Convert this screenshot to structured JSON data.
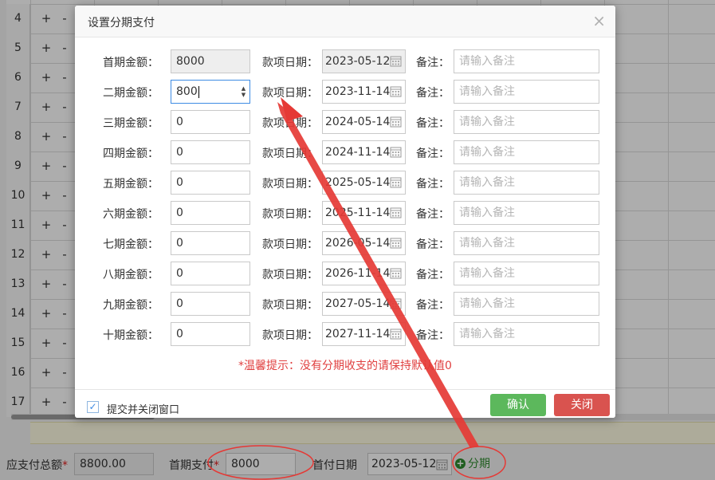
{
  "background": {
    "rows": [
      "4",
      "5",
      "6",
      "7",
      "8",
      "9",
      "10",
      "11",
      "12",
      "13",
      "14",
      "15",
      "16",
      "17"
    ],
    "plus": "+",
    "minus": "-",
    "footer": {
      "total_label": "应支付总额",
      "total_value": "8800.00",
      "first_label": "首期支付",
      "first_value": "8000",
      "first_date_label": "首付日期",
      "first_date_value": "2023-05-12",
      "installment_label": "分期",
      "required_mark": "*"
    }
  },
  "modal": {
    "title": "设置分期支付",
    "close_glyph": "×",
    "date_label": "款项日期：",
    "note_label": "备注：",
    "note_placeholder": "请输入备注",
    "installments": [
      {
        "label": "首期金额：",
        "amount": "8000",
        "date": "2023-05-12"
      },
      {
        "label": "二期金额：",
        "amount": "800",
        "date": "2023-11-14"
      },
      {
        "label": "三期金额：",
        "amount": "0",
        "date": "2024-05-14"
      },
      {
        "label": "四期金额：",
        "amount": "0",
        "date": "2024-11-14"
      },
      {
        "label": "五期金额：",
        "amount": "0",
        "date": "2025-05-14"
      },
      {
        "label": "六期金额：",
        "amount": "0",
        "date": "2025-11-14"
      },
      {
        "label": "七期金额：",
        "amount": "0",
        "date": "2026-05-14"
      },
      {
        "label": "八期金额：",
        "amount": "0",
        "date": "2026-11-14"
      },
      {
        "label": "九期金额：",
        "amount": "0",
        "date": "2027-05-14"
      },
      {
        "label": "十期金额：",
        "amount": "0",
        "date": "2027-11-14"
      }
    ],
    "tip": "*温馨提示：没有分期收支的请保持默认值0",
    "close_on_submit_label": "提交并关闭窗口",
    "close_on_submit_checked": true,
    "confirm_label": "确认",
    "close_label": "关闭"
  },
  "colors": {
    "confirm": "#5cb85c",
    "close": "#d9534f",
    "tip": "#e04040",
    "annotation": "#e53935",
    "installment_link": "#2e8b2e"
  }
}
